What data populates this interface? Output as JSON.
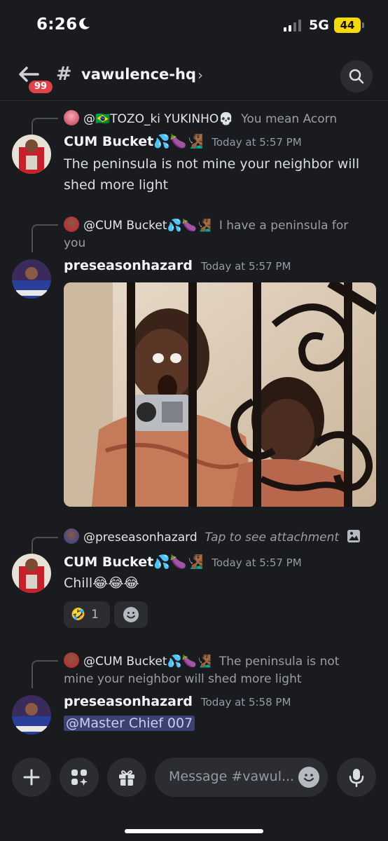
{
  "status_bar": {
    "time": "6:26",
    "network": "5G",
    "battery": "44"
  },
  "header": {
    "unread_count": "99",
    "channel_name": "vawulence-hq"
  },
  "messages": [
    {
      "reply_to_name": "@🇧🇷TOZO_ki YUKINHO💀",
      "reply_to_text": "You mean Acorn",
      "author": "CUM Bucket💦🍆🧏🏾‍♂️",
      "timestamp": "Today at 5:57 PM",
      "text": "The peninsula is not mine your neighbor will shed more light"
    },
    {
      "reply_to_name": "@CUM Bucket💦🍆🧏🏾‍♂️",
      "reply_to_text": "I have a peninsula for you",
      "author": "preseasonhazard",
      "timestamp": "Today at 5:57 PM",
      "text": ""
    },
    {
      "reply_to_name": "@preseasonhazard",
      "reply_to_text": "Tap to see attachment",
      "author": "CUM Bucket💦🍆🧏🏾‍♂️",
      "timestamp": "Today at 5:57 PM",
      "text": "Chill😂😂😂",
      "reaction": {
        "emoji": "🤣",
        "count": "1"
      }
    },
    {
      "reply_to_name": "@CUM Bucket💦🍆🧏🏾‍♂️",
      "reply_to_text": "The peninsula is not mine your neighbor will shed more light",
      "author": "preseasonhazard",
      "timestamp": "Today at 5:58 PM",
      "mention": "@Master Chief 007"
    }
  ],
  "composer": {
    "placeholder": "Message #vawul..."
  },
  "colors": {
    "background": "#1a1b1f",
    "surface": "#2b2d31",
    "badge": "#e2414a",
    "mention_bg": "#3c4270",
    "battery": "#f5d90a"
  }
}
